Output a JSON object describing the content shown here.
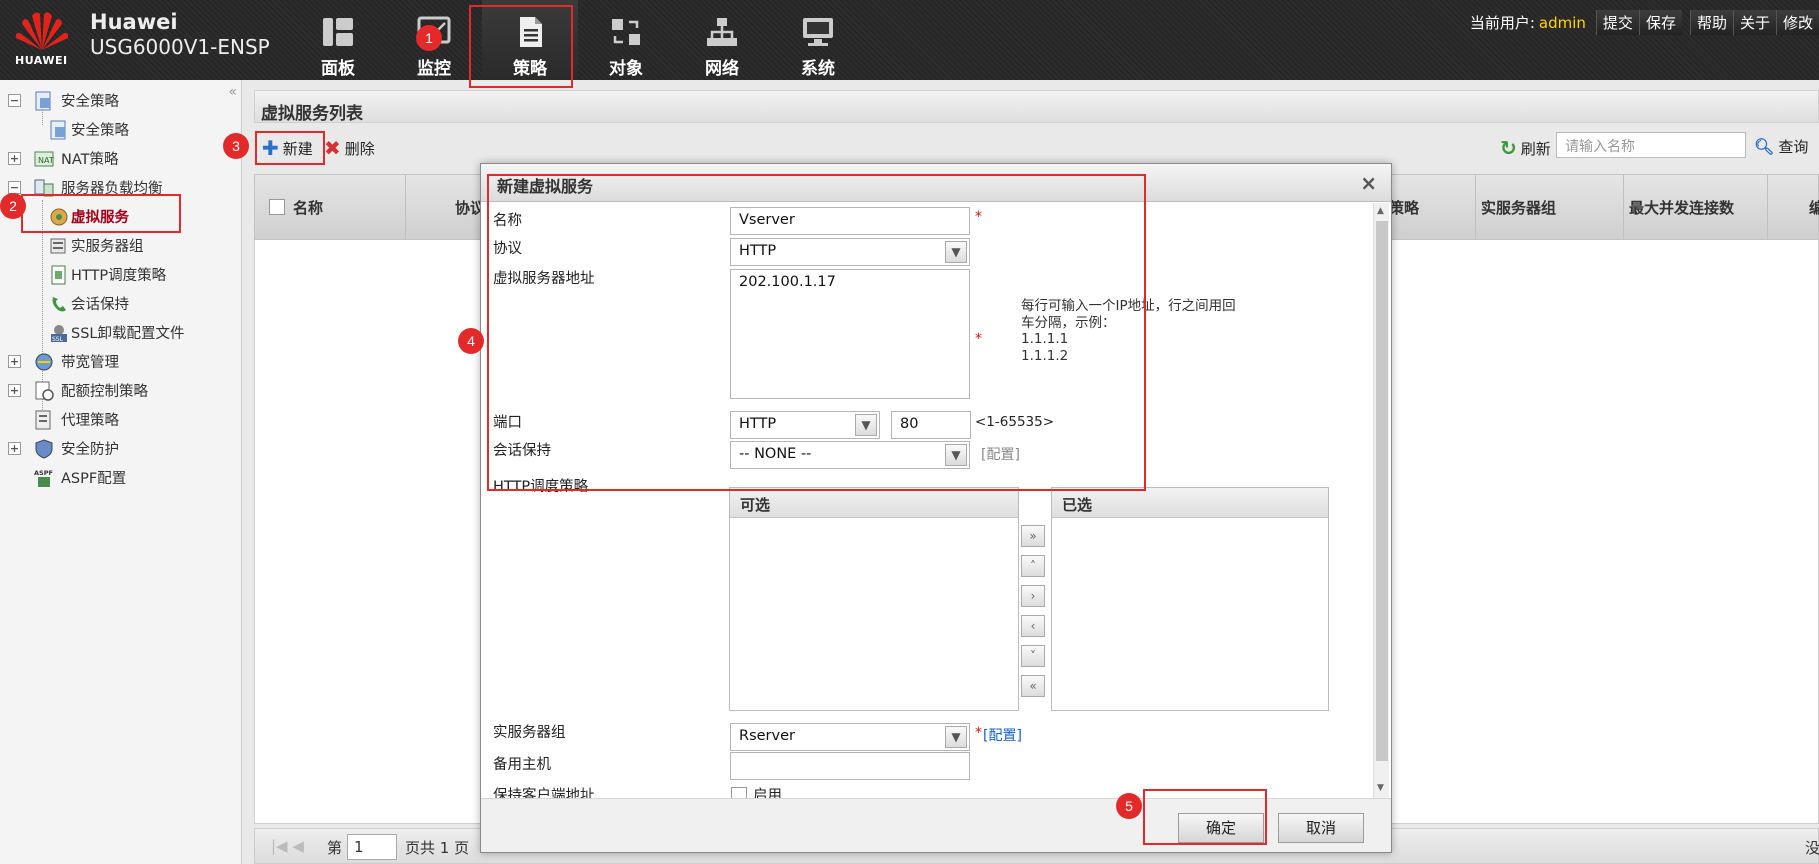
{
  "header": {
    "brand_name": "Huawei",
    "brand_model": "USG6000V1-ENSP",
    "logo_text": "HUAWEI",
    "nav": [
      {
        "label": "面板",
        "icon": "dashboard-icon"
      },
      {
        "label": "监控",
        "icon": "monitor-icon"
      },
      {
        "label": "策略",
        "icon": "policy-document-icon",
        "active": true
      },
      {
        "label": "对象",
        "icon": "object-icon"
      },
      {
        "label": "网络",
        "icon": "network-icon"
      },
      {
        "label": "系统",
        "icon": "system-icon"
      }
    ],
    "user_label": "当前用户:",
    "user": "admin",
    "buttons": [
      "提交",
      "保存",
      "帮助",
      "关于",
      "修改"
    ]
  },
  "sidebar": {
    "items": [
      {
        "label": "安全策略",
        "level": 1,
        "expander": "−"
      },
      {
        "label": "安全策略",
        "level": 2
      },
      {
        "label": "NAT策略",
        "level": 1,
        "expander": "+"
      },
      {
        "label": "服务器负载均衡",
        "level": 1,
        "expander": "−"
      },
      {
        "label": "虚拟服务",
        "level": 2,
        "selected": true
      },
      {
        "label": "实服务器组",
        "level": 2
      },
      {
        "label": "HTTP调度策略",
        "level": 2
      },
      {
        "label": "会话保持",
        "level": 2
      },
      {
        "label": "SSL卸载配置文件",
        "level": 2
      },
      {
        "label": "带宽管理",
        "level": 1,
        "expander": "+"
      },
      {
        "label": "配额控制策略",
        "level": 1,
        "expander": "+"
      },
      {
        "label": "代理策略",
        "level": 1
      },
      {
        "label": "安全防护",
        "level": 1,
        "expander": "+"
      },
      {
        "label": "ASPF配置",
        "level": 1
      }
    ]
  },
  "main": {
    "list_title": "虚拟服务列表",
    "toolbar": {
      "new_label": "新建",
      "delete_label": "删除",
      "refresh_label": "刷新",
      "search_placeholder": "请输入名称",
      "query_label": "查询"
    },
    "columns": [
      "名称",
      "协议",
      "策略",
      "实服务器组",
      "最大并发连接数",
      "编"
    ],
    "pager": {
      "prefix": "第",
      "page": "1",
      "total": "页共 1 页",
      "right_text": "没"
    }
  },
  "dialog": {
    "title": "新建虚拟服务",
    "fields": {
      "name_label": "名称",
      "name_value": "Vserver",
      "protocol_label": "协议",
      "protocol_value": "HTTP",
      "address_label": "虚拟服务器地址",
      "address_value": "202.100.1.17",
      "address_hint": [
        "每行可输入一个IP地址，行之间用回",
        "车分隔，示例：",
        "1.1.1.1",
        "1.1.1.2"
      ],
      "port_label": "端口",
      "port_type": "HTTP",
      "port_value": "80",
      "port_range": "<1-65535>",
      "session_label": "会话保持",
      "session_value": "-- NONE --",
      "config_link": "[配置]",
      "http_policy_label": "HTTP调度策略",
      "available_header": "可选",
      "selected_header": "已选",
      "server_group_label": "实服务器组",
      "server_group_value": "Rserver",
      "backup_host_label": "备用主机",
      "keep_client_label": "保持客户端地址",
      "enable_label": "启用"
    },
    "move_buttons": [
      "»",
      "˄",
      "›",
      "‹",
      "˅",
      "«"
    ],
    "ok_label": "确定",
    "cancel_label": "取消"
  },
  "annotations": [
    "1",
    "2",
    "3",
    "4",
    "5"
  ],
  "colors": {
    "accent_red": "#e32a2a",
    "user_yellow": "#ffd400",
    "selected_text": "#a3001a",
    "link_blue": "#1060c8"
  }
}
